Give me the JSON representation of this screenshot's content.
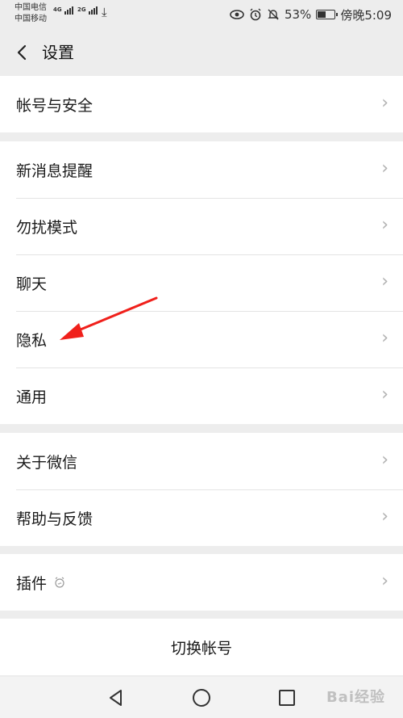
{
  "status_bar": {
    "carrier1": "中国电信",
    "carrier2": "中国移动",
    "net1": "4G",
    "net2": "2G",
    "battery_text": "53%",
    "battery_level": 0.53,
    "time": "傍晚5:09"
  },
  "header": {
    "title": "设置"
  },
  "groups": [
    {
      "items": [
        {
          "label": "帐号与安全"
        }
      ]
    },
    {
      "items": [
        {
          "label": "新消息提醒"
        },
        {
          "label": "勿扰模式"
        },
        {
          "label": "聊天"
        },
        {
          "label": "隐私"
        },
        {
          "label": "通用"
        }
      ]
    },
    {
      "items": [
        {
          "label": "关于微信"
        },
        {
          "label": "帮助与反馈"
        }
      ]
    },
    {
      "items": [
        {
          "label": "插件"
        }
      ]
    }
  ],
  "switch_account": {
    "label": "切换帐号"
  },
  "watermark": {
    "text": "Bai经验"
  },
  "colors": {
    "background": "#ededed",
    "arrow": "#f0201b",
    "chevron": "#b2b2b2"
  }
}
